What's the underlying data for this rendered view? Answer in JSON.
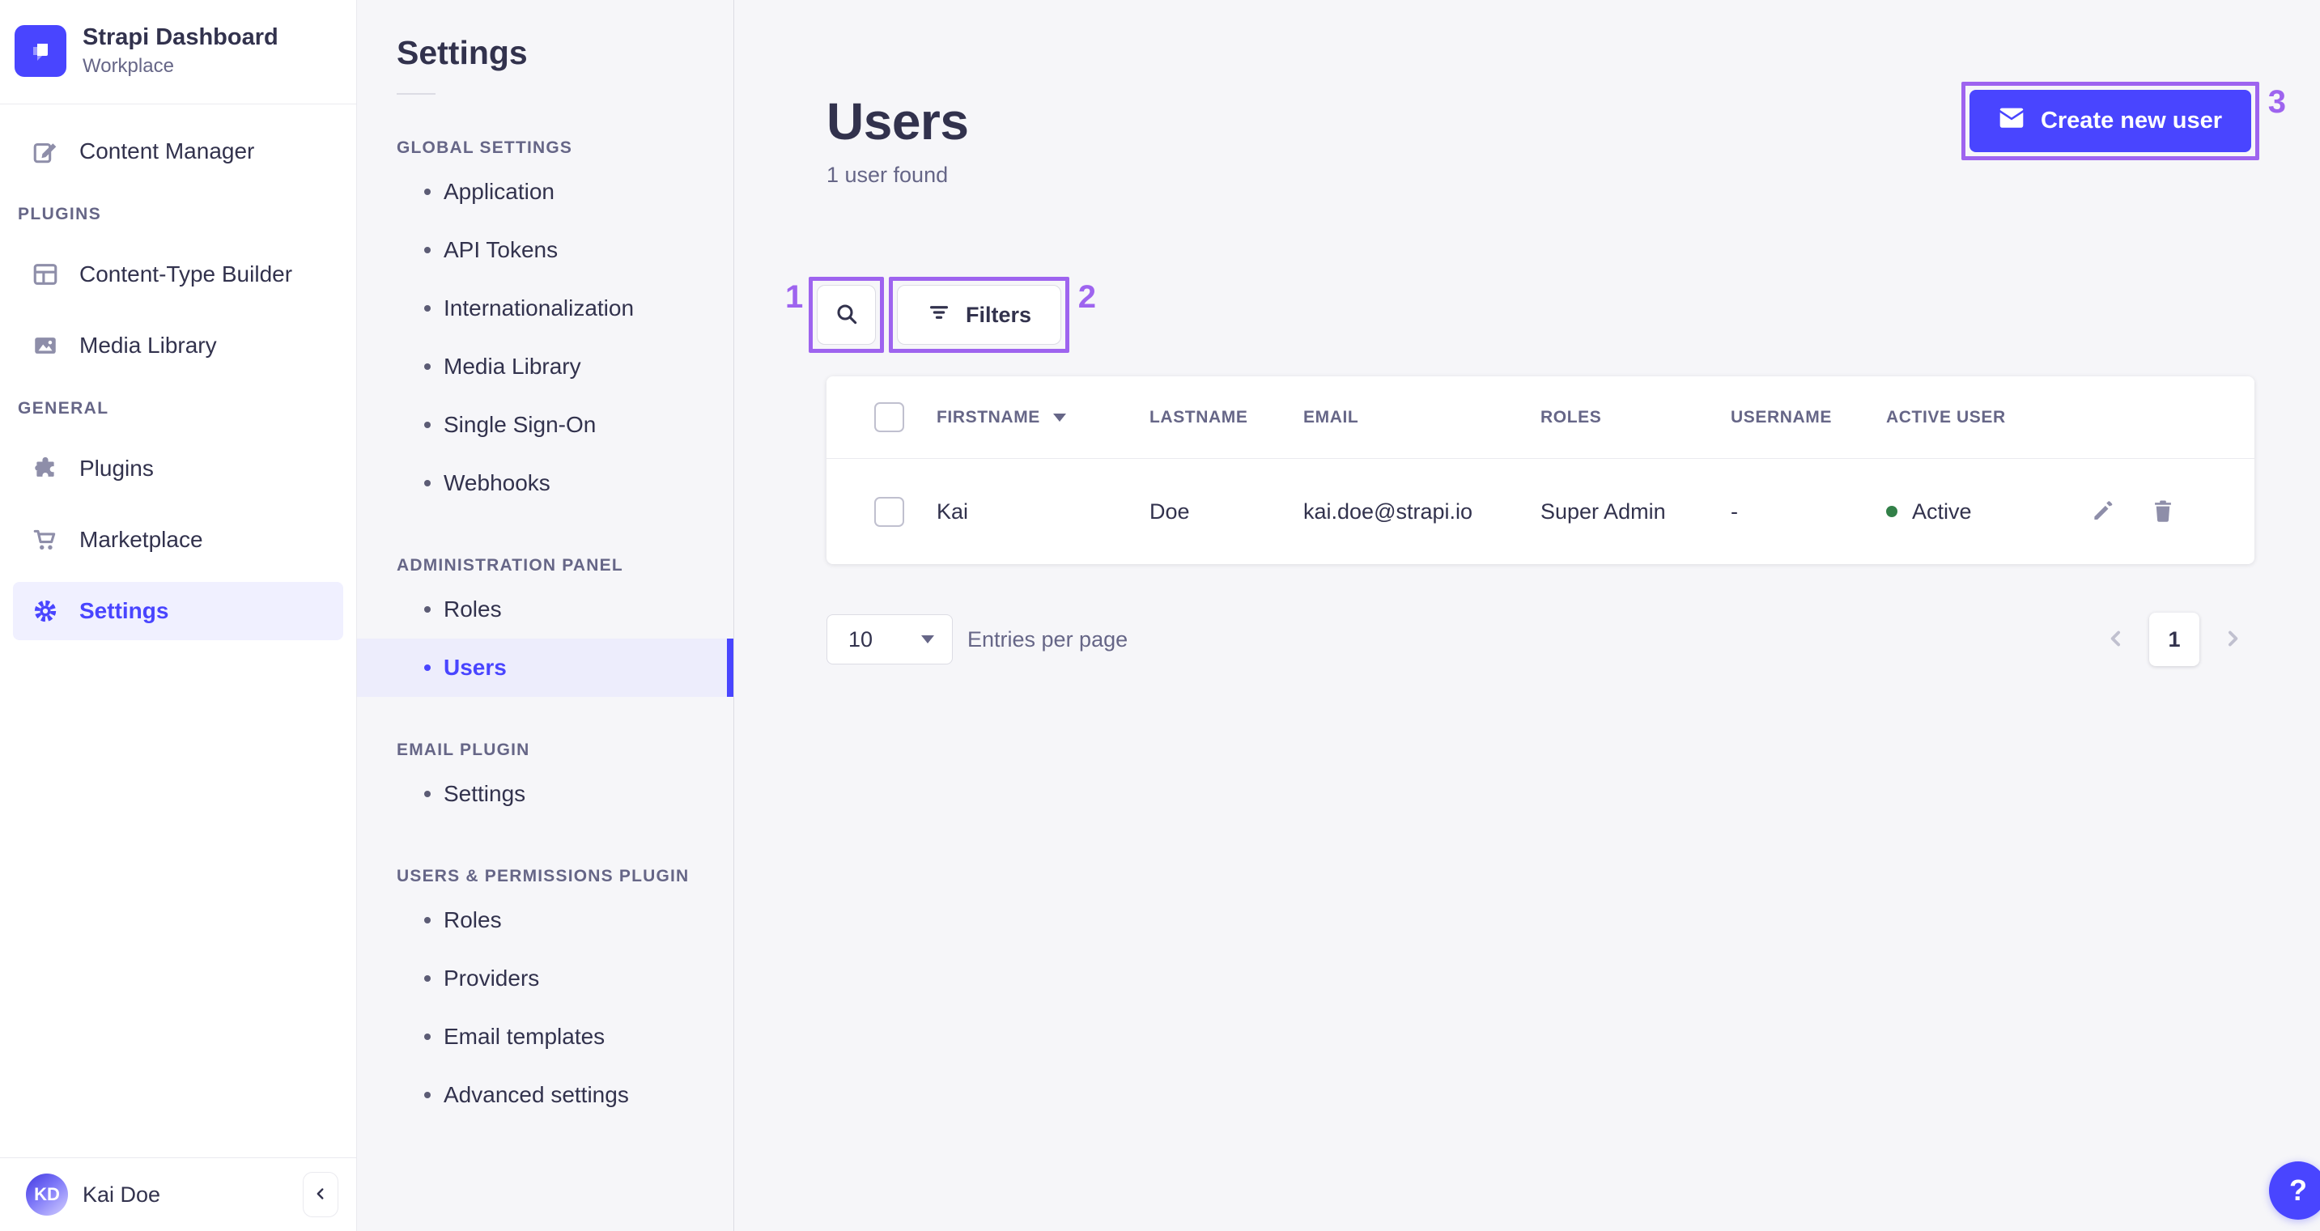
{
  "app": {
    "name": "Strapi Dashboard",
    "workspace": "Workplace"
  },
  "sidebar": {
    "top_items": [
      {
        "label": "Content Manager"
      }
    ],
    "sections": [
      {
        "label": "PLUGINS",
        "items": [
          {
            "label": "Content-Type Builder"
          },
          {
            "label": "Media Library"
          }
        ]
      },
      {
        "label": "GENERAL",
        "items": [
          {
            "label": "Plugins"
          },
          {
            "label": "Marketplace"
          },
          {
            "label": "Settings"
          }
        ]
      }
    ],
    "footer": {
      "user_initials": "KD",
      "user_name": "Kai Doe"
    }
  },
  "subnav": {
    "title": "Settings",
    "sections": [
      {
        "label": "GLOBAL SETTINGS",
        "items": [
          "Application",
          "API Tokens",
          "Internationalization",
          "Media Library",
          "Single Sign-On",
          "Webhooks"
        ]
      },
      {
        "label": "ADMINISTRATION PANEL",
        "items": [
          "Roles",
          "Users"
        ]
      },
      {
        "label": "EMAIL PLUGIN",
        "items": [
          "Settings"
        ]
      },
      {
        "label": "USERS & PERMISSIONS PLUGIN",
        "items": [
          "Roles",
          "Providers",
          "Email templates",
          "Advanced settings"
        ]
      }
    ]
  },
  "main": {
    "title": "Users",
    "subtitle": "1 user found",
    "create_button_label": "Create new user",
    "filters_button_label": "Filters",
    "table": {
      "columns": [
        "FIRSTNAME",
        "LASTNAME",
        "EMAIL",
        "ROLES",
        "USERNAME",
        "ACTIVE USER"
      ],
      "rows": [
        {
          "firstname": "Kai",
          "lastname": "Doe",
          "email": "kai.doe@strapi.io",
          "roles": "Super Admin",
          "username": "-",
          "active_label": "Active"
        }
      ]
    },
    "pagination": {
      "page_size": "10",
      "entries_label": "Entries per page",
      "current_page": "1"
    },
    "help_label": "?"
  },
  "annotations": {
    "box1": "1",
    "box2": "2",
    "box3": "3"
  },
  "colors": {
    "primary": "#4945ff",
    "text": "#32324d",
    "muted": "#666687",
    "icon_gray": "#8e8ea9",
    "border": "#dcdce4",
    "active_bg": "#ededfc",
    "success": "#328048",
    "annotation": "#9e64ef",
    "panel_bg": "#f6f6f9"
  }
}
